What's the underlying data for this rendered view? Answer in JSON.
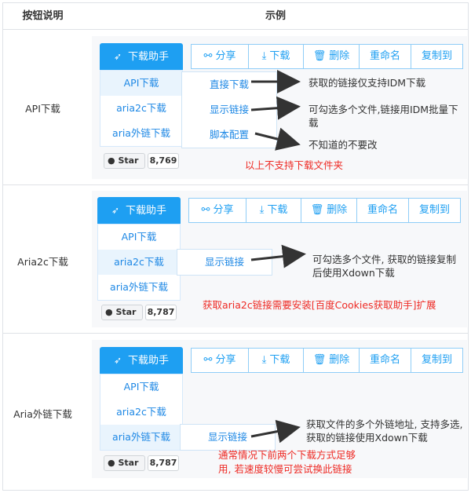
{
  "header": {
    "col1": "按钮说明",
    "col2": "示例"
  },
  "toolbar": {
    "main_button": "下载助手",
    "share": "分享",
    "download": "下载",
    "delete": "删除",
    "rename": "重命名",
    "copy_to": "复制到"
  },
  "menu": {
    "api": "API下载",
    "aria2c": "aria2c下载",
    "external": "aria外链下载"
  },
  "rows": [
    {
      "label": "API下载",
      "sub_items": [
        "直接下载",
        "显示链接",
        "脚本配置"
      ],
      "notes": [
        "获取的链接仅支持IDM下载",
        "可勾选多个文件,链接用IDM批量下载",
        "不知道的不要改"
      ],
      "red_note": "以上不支持下载文件夹",
      "star_label": "Star",
      "star_count": "8,769"
    },
    {
      "label": "Aria2c下载",
      "sub_items": [
        "显示链接"
      ],
      "notes": [
        "可勾选多个文件, 获取的链接复制后使用Xdown下载"
      ],
      "red_note": "获取aria2c链接需要安装[百度Cookies获取助手]扩展",
      "star_label": "Star",
      "star_count": "8,787"
    },
    {
      "label": "Aria外链下载",
      "sub_items": [
        "显示链接"
      ],
      "notes": [
        "获取文件的多个外链地址, 支持多选, 获取的链接使用Xdown下载"
      ],
      "red_note": "通常情况下前两个下载方式足够用, 若速度较慢可尝试换此链接",
      "star_label": "Star",
      "star_count": "8,787"
    }
  ],
  "colors": {
    "accent": "#1e9ff2",
    "red": "#ee2a24",
    "border": "#dfe2e6"
  },
  "icons": {
    "main": "rocket-icon",
    "share": "share-icon",
    "download": "download-icon",
    "delete": "trash-icon",
    "github": "github-icon"
  }
}
